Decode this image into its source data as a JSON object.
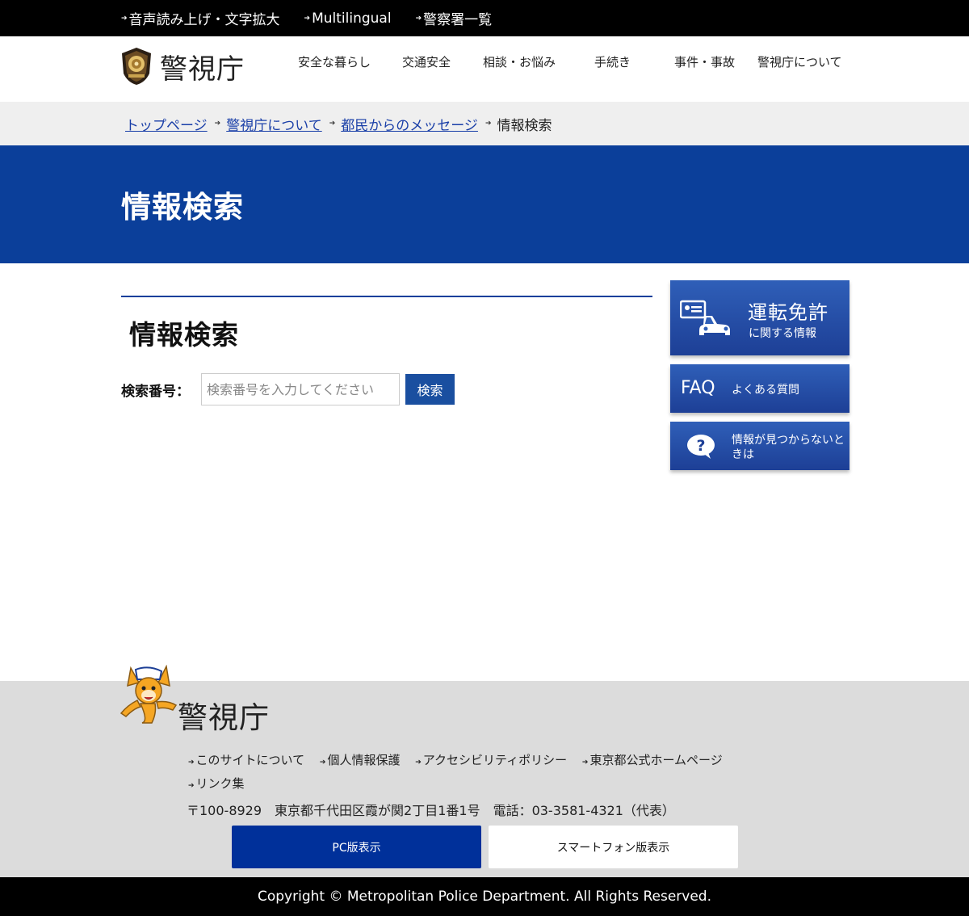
{
  "utility": {
    "items": [
      {
        "label": "音声読み上げ・文字拡大"
      },
      {
        "label": "Multilingual"
      },
      {
        "label": "警察署一覧"
      }
    ]
  },
  "header": {
    "logo_text": "警視庁",
    "nav": [
      {
        "label": "安全な暮らし"
      },
      {
        "label": "交通安全"
      },
      {
        "label": "相談・お悩み"
      },
      {
        "label": "手続き"
      },
      {
        "label": "事件・事故"
      },
      {
        "label": "警視庁について"
      }
    ]
  },
  "breadcrumb": {
    "links": [
      {
        "label": "トップページ"
      },
      {
        "label": "警視庁について"
      },
      {
        "label": "都民からのメッセージ"
      }
    ],
    "current": "情報検索"
  },
  "page": {
    "title": "情報検索",
    "heading": "情報検索"
  },
  "search": {
    "label": "検索番号：",
    "placeholder": "検索番号を入力してください",
    "button_label": "検索"
  },
  "sidebar": {
    "license": {
      "title": "運転免許",
      "subtitle": "に関する情報",
      "icon": "driver-license-car-icon"
    },
    "faq": {
      "title": "FAQ",
      "subtitle": "よくある質問"
    },
    "help": {
      "text": "情報が見つからないときは",
      "icon": "question-bubble-icon"
    }
  },
  "footer": {
    "logo_text": "警視庁",
    "links": [
      {
        "label": "このサイトについて"
      },
      {
        "label": "個人情報保護"
      },
      {
        "label": "アクセシビリティポリシー"
      },
      {
        "label": "東京都公式ホームページ"
      },
      {
        "label": "リンク集"
      }
    ],
    "address": "〒100-8929　東京都千代田区霞が関2丁目1番1号　電話：03-3581-4321（代表）",
    "pc_label": "PC版表示",
    "sp_label": "スマートフォン版表示",
    "copyright": "Copyright © Metropolitan Police Department. All Rights Reserved."
  },
  "colors": {
    "brand_blue": "#0b3f9a",
    "pc_button": "#00309a",
    "banner_blue": "#2f5fb8"
  }
}
